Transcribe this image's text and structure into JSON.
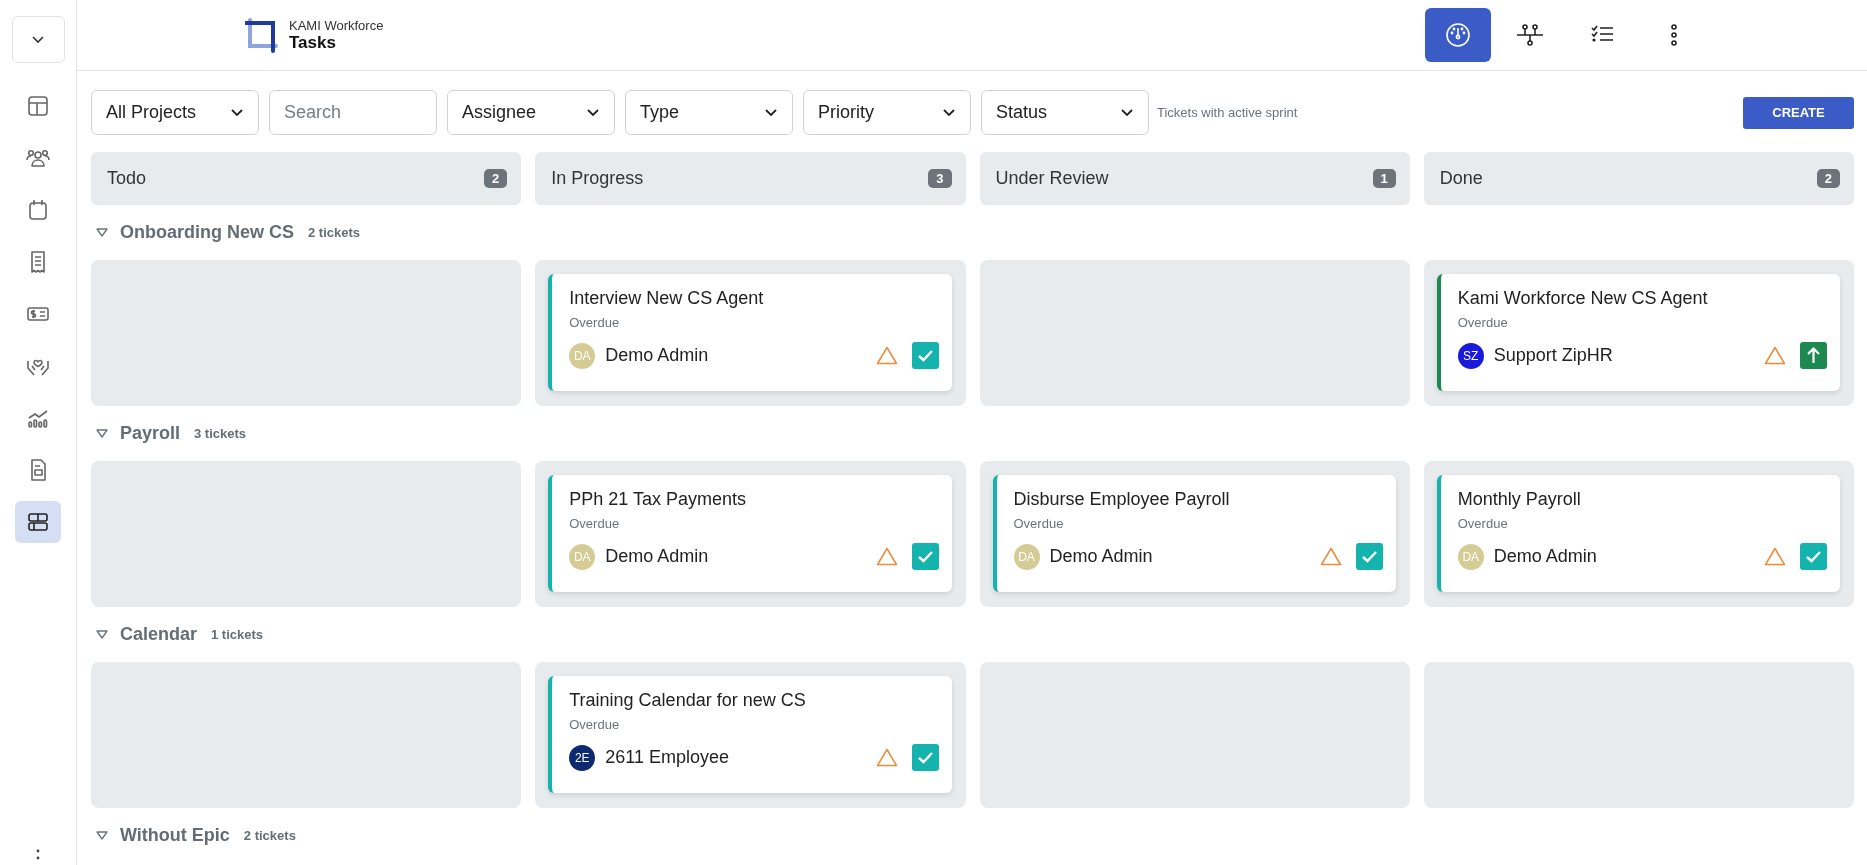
{
  "sidebar": {
    "items": [
      {
        "selected": false
      },
      {
        "selected": false
      },
      {
        "selected": false
      },
      {
        "selected": false
      },
      {
        "selected": false
      },
      {
        "selected": false
      },
      {
        "selected": false
      },
      {
        "selected": false
      },
      {
        "selected": true
      }
    ]
  },
  "header": {
    "app_name": "KAMI Workforce",
    "title": "Tasks",
    "views": [
      {
        "selected": true
      },
      {
        "selected": false
      },
      {
        "selected": false
      },
      {
        "selected": false
      }
    ]
  },
  "filters": [
    {
      "kind": "select",
      "label": "All Projects"
    },
    {
      "kind": "search",
      "placeholder": "Search"
    },
    {
      "kind": "select",
      "label": "Assignee"
    },
    {
      "kind": "select",
      "label": "Type"
    },
    {
      "kind": "select",
      "label": "Priority"
    },
    {
      "kind": "select",
      "label": "Status"
    }
  ],
  "filter_note": "Tickets with active sprint",
  "create_button": "CREATE",
  "columns": [
    {
      "name": "Todo",
      "count": "2"
    },
    {
      "name": "In Progress",
      "count": "3"
    },
    {
      "name": "Under Review",
      "count": "1"
    },
    {
      "name": "Done",
      "count": "2"
    }
  ],
  "groups": [
    {
      "name": "Onboarding New CS",
      "count": "2 tickets",
      "expanded": true,
      "cells": [
        [],
        [
          {
            "title": "Interview New CS Agent",
            "due": "Overdue",
            "initials": "DA",
            "assignee": "Demo Admin",
            "color": "#d4cc94",
            "kind": "task"
          }
        ],
        [],
        [
          {
            "title": "Kami Workforce New CS Agent",
            "due": "Overdue",
            "initials": "SZ",
            "assignee": "Support ZipHR",
            "color": "#1a1adc",
            "kind": "story"
          }
        ]
      ]
    },
    {
      "name": "Payroll",
      "count": "3 tickets",
      "expanded": true,
      "cells": [
        [],
        [
          {
            "title": "PPh 21 Tax Payments",
            "due": "Overdue",
            "initials": "DA",
            "assignee": "Demo Admin",
            "color": "#d4cc94",
            "kind": "task"
          }
        ],
        [
          {
            "title": "Disburse Employee Payroll",
            "due": "Overdue",
            "initials": "DA",
            "assignee": "Demo Admin",
            "color": "#d4cc94",
            "kind": "task"
          }
        ],
        [
          {
            "title": "Monthly Payroll",
            "due": "Overdue",
            "initials": "DA",
            "assignee": "Demo Admin",
            "color": "#d4cc94",
            "kind": "task"
          }
        ]
      ]
    },
    {
      "name": "Calendar",
      "count": "1 tickets",
      "expanded": true,
      "cells": [
        [],
        [
          {
            "title": "Training Calendar for new CS",
            "due": "Overdue",
            "initials": "2E",
            "assignee": "2611 Employee",
            "color": "#0d2a6e",
            "kind": "task"
          }
        ],
        [],
        []
      ]
    },
    {
      "name": "Without Epic",
      "count": "2 tickets",
      "expanded": true
    }
  ]
}
